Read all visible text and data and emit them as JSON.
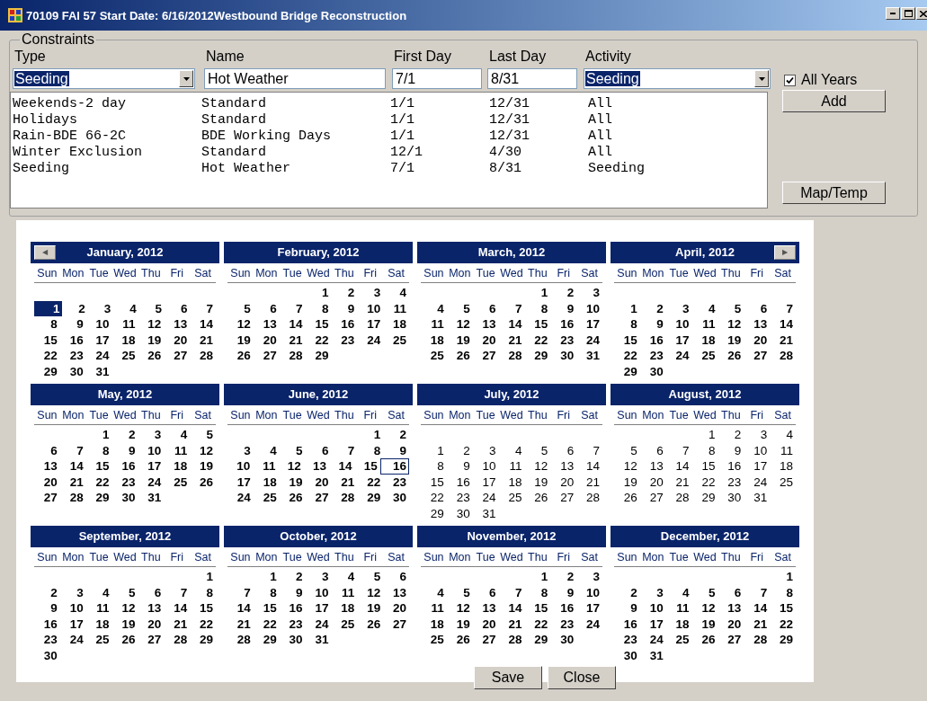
{
  "window": {
    "title": "70109 FAI 57 Start Date: 6/16/2012Westbound Bridge Reconstruction"
  },
  "constraints": {
    "title": "Constraints",
    "fields": [
      {
        "label": "Type",
        "kind": "combo",
        "value": "Seeding",
        "text_selected": true
      },
      {
        "label": "Name",
        "kind": "text",
        "value": "Hot Weather",
        "text_selected": false
      },
      {
        "label": "First Day",
        "kind": "text",
        "value": "7/1",
        "text_selected": false
      },
      {
        "label": "Last Day",
        "kind": "text",
        "value": "8/31",
        "text_selected": false
      },
      {
        "label": "Activity",
        "kind": "combo",
        "value": "Seeding",
        "text_selected": true
      }
    ],
    "all_years": {
      "label": "All Years",
      "checked": true
    },
    "add_button": "Add",
    "map_button": "Map/Temp",
    "rows": [
      [
        "Weekends-2 day",
        "Standard",
        "1/1",
        "12/31",
        "All"
      ],
      [
        "Holidays",
        "Standard",
        "1/1",
        "12/31",
        "All"
      ],
      [
        "Rain-BDE 66-2C",
        "BDE Working Days",
        "1/1",
        "12/31",
        "All"
      ],
      [
        "Winter Exclusion",
        "Standard",
        "12/1",
        "4/30",
        "All"
      ],
      [
        "Seeding",
        "Hot Weather",
        "7/1",
        "8/31",
        "Seeding"
      ]
    ]
  },
  "calendar": {
    "prev_button": "◀",
    "next_button": "▶",
    "months": [
      {
        "title": "January, 2012",
        "bold": true,
        "leading_blank_week": true,
        "weekdays": [
          "Sun",
          "Mon",
          "Tue",
          "Wed",
          "Thu",
          "Fri",
          "Sat"
        ],
        "weeks": [
          {
            "sun": {
              "day": "1",
              "kind": "selected"
            },
            "mon": "2",
            "tue": "3",
            "wed": "4",
            "thu": "5",
            "fri": "6",
            "sat": "7"
          },
          {
            "sun": "8",
            "mon": "9",
            "tue": "10",
            "wed": "11",
            "thu": "12",
            "fri": "13",
            "sat": "14"
          },
          {
            "sun": "15",
            "mon": "16",
            "tue": "17",
            "wed": "18",
            "thu": "19",
            "fri": "20",
            "sat": "21"
          },
          {
            "sun": "22",
            "mon": "23",
            "tue": "24",
            "wed": "25",
            "thu": "26",
            "fri": "27",
            "sat": "28"
          },
          {
            "sun": "29",
            "mon": "30",
            "tue": "31"
          }
        ]
      },
      {
        "title": "February, 2012",
        "bold": true,
        "leading_blank_week": false,
        "weekdays": [
          "Sun",
          "Mon",
          "Tue",
          "Wed",
          "Thu",
          "Fri",
          "Sat"
        ],
        "weeks": [
          {
            "wed": "1",
            "thu": "2",
            "fri": "3",
            "sat": "4"
          },
          {
            "sun": "5",
            "mon": "6",
            "tue": "7",
            "wed": "8",
            "thu": "9",
            "fri": "10",
            "sat": "11"
          },
          {
            "sun": "12",
            "mon": "13",
            "tue": "14",
            "wed": "15",
            "thu": "16",
            "fri": "17",
            "sat": "18"
          },
          {
            "sun": "19",
            "mon": "20",
            "tue": "21",
            "wed": "22",
            "thu": "23",
            "fri": "24",
            "sat": "25"
          },
          {
            "sun": "26",
            "mon": "27",
            "tue": "28",
            "wed": "29"
          }
        ]
      },
      {
        "title": "March, 2012",
        "bold": true,
        "leading_blank_week": false,
        "weekdays": [
          "Sun",
          "Mon",
          "Tue",
          "Wed",
          "Thu",
          "Fri",
          "Sat"
        ],
        "weeks": [
          {
            "thu": "1",
            "fri": "2",
            "sat": "3"
          },
          {
            "sun": "4",
            "mon": "5",
            "tue": "6",
            "wed": "7",
            "thu": "8",
            "fri": "9",
            "sat": "10"
          },
          {
            "sun": "11",
            "mon": "12",
            "tue": "13",
            "wed": "14",
            "thu": "15",
            "fri": "16",
            "sat": "17"
          },
          {
            "sun": "18",
            "mon": "19",
            "tue": "20",
            "wed": "21",
            "thu": "22",
            "fri": "23",
            "sat": "24"
          },
          {
            "sun": "25",
            "mon": "26",
            "tue": "27",
            "wed": "28",
            "thu": "29",
            "fri": "30",
            "sat": "31"
          }
        ]
      },
      {
        "title": "April, 2012",
        "bold": true,
        "leading_blank_week": true,
        "weekdays": [
          "Sun",
          "Mon",
          "Tue",
          "Wed",
          "Thu",
          "Fri",
          "Sat"
        ],
        "weeks": [
          {
            "sun": "1",
            "mon": "2",
            "tue": "3",
            "wed": "4",
            "thu": "5",
            "fri": "6",
            "sat": "7"
          },
          {
            "sun": "8",
            "mon": "9",
            "tue": "10",
            "wed": "11",
            "thu": "12",
            "fri": "13",
            "sat": "14"
          },
          {
            "sun": "15",
            "mon": "16",
            "tue": "17",
            "wed": "18",
            "thu": "19",
            "fri": "20",
            "sat": "21"
          },
          {
            "sun": "22",
            "mon": "23",
            "tue": "24",
            "wed": "25",
            "thu": "26",
            "fri": "27",
            "sat": "28"
          },
          {
            "sun": "29",
            "mon": "30"
          }
        ]
      },
      {
        "title": "May, 2012",
        "bold": true,
        "leading_blank_week": false,
        "weekdays": [
          "Sun",
          "Mon",
          "Tue",
          "Wed",
          "Thu",
          "Fri",
          "Sat"
        ],
        "weeks": [
          {
            "tue": "1",
            "wed": "2",
            "thu": "3",
            "fri": "4",
            "sat": "5"
          },
          {
            "sun": "6",
            "mon": "7",
            "tue": "8",
            "wed": "9",
            "thu": "10",
            "fri": "11",
            "sat": "12"
          },
          {
            "sun": "13",
            "mon": "14",
            "tue": "15",
            "wed": "16",
            "thu": "17",
            "fri": "18",
            "sat": "19"
          },
          {
            "sun": "20",
            "mon": "21",
            "tue": "22",
            "wed": "23",
            "thu": "24",
            "fri": "25",
            "sat": "26"
          },
          {
            "sun": "27",
            "mon": "28",
            "tue": "29",
            "wed": "30",
            "thu": "31"
          }
        ]
      },
      {
        "title": "June, 2012",
        "bold": true,
        "leading_blank_week": false,
        "weekdays": [
          "Sun",
          "Mon",
          "Tue",
          "Wed",
          "Thu",
          "Fri",
          "Sat"
        ],
        "weeks": [
          {
            "fri": "1",
            "sat": "2"
          },
          {
            "sun": "3",
            "mon": "4",
            "tue": "5",
            "wed": "6",
            "thu": "7",
            "fri": "8",
            "sat": "9"
          },
          {
            "sun": "10",
            "mon": "11",
            "tue": "12",
            "wed": "13",
            "thu": "14",
            "fri": "15",
            "sat": {
              "day": "16",
              "kind": "today"
            }
          },
          {
            "sun": "17",
            "mon": "18",
            "tue": "19",
            "wed": "20",
            "thu": "21",
            "fri": "22",
            "sat": "23"
          },
          {
            "sun": "24",
            "mon": "25",
            "tue": "26",
            "wed": "27",
            "thu": "28",
            "fri": "29",
            "sat": "30"
          }
        ]
      },
      {
        "title": "July, 2012",
        "bold": false,
        "leading_blank_week": true,
        "weekdays": [
          "Sun",
          "Mon",
          "Tue",
          "Wed",
          "Thu",
          "Fri",
          "Sat"
        ],
        "weeks": [
          {
            "sun": "1",
            "mon": "2",
            "tue": "3",
            "wed": "4",
            "thu": "5",
            "fri": "6",
            "sat": "7"
          },
          {
            "sun": "8",
            "mon": "9",
            "tue": "10",
            "wed": "11",
            "thu": "12",
            "fri": "13",
            "sat": "14"
          },
          {
            "sun": "15",
            "mon": "16",
            "tue": "17",
            "wed": "18",
            "thu": "19",
            "fri": "20",
            "sat": "21"
          },
          {
            "sun": "22",
            "mon": "23",
            "tue": "24",
            "wed": "25",
            "thu": "26",
            "fri": "27",
            "sat": "28"
          },
          {
            "sun": "29",
            "mon": "30",
            "tue": "31"
          }
        ]
      },
      {
        "title": "August, 2012",
        "bold": false,
        "leading_blank_week": false,
        "weekdays": [
          "Sun",
          "Mon",
          "Tue",
          "Wed",
          "Thu",
          "Fri",
          "Sat"
        ],
        "weeks": [
          {
            "wed": "1",
            "thu": "2",
            "fri": "3",
            "sat": "4"
          },
          {
            "sun": "5",
            "mon": "6",
            "tue": "7",
            "wed": "8",
            "thu": "9",
            "fri": "10",
            "sat": "11"
          },
          {
            "sun": "12",
            "mon": "13",
            "tue": "14",
            "wed": "15",
            "thu": "16",
            "fri": "17",
            "sat": "18"
          },
          {
            "sun": "19",
            "mon": "20",
            "tue": "21",
            "wed": "22",
            "thu": "23",
            "fri": "24",
            "sat": "25"
          },
          {
            "sun": "26",
            "mon": "27",
            "tue": "28",
            "wed": "29",
            "thu": "30",
            "fri": "31"
          }
        ]
      },
      {
        "title": "September, 2012",
        "bold": true,
        "leading_blank_week": false,
        "weekdays": [
          "Sun",
          "Mon",
          "Tue",
          "Wed",
          "Thu",
          "Fri",
          "Sat"
        ],
        "weeks": [
          {
            "sat": "1"
          },
          {
            "sun": "2",
            "mon": "3",
            "tue": "4",
            "wed": "5",
            "thu": "6",
            "fri": "7",
            "sat": "8"
          },
          {
            "sun": "9",
            "mon": "10",
            "tue": "11",
            "wed": "12",
            "thu": "13",
            "fri": "14",
            "sat": "15"
          },
          {
            "sun": "16",
            "mon": "17",
            "tue": "18",
            "wed": "19",
            "thu": "20",
            "fri": "21",
            "sat": "22"
          },
          {
            "sun": "23",
            "mon": "24",
            "tue": "25",
            "wed": "26",
            "thu": "27",
            "fri": "28",
            "sat": "29"
          },
          {
            "sun": "30"
          }
        ]
      },
      {
        "title": "October, 2012",
        "bold": true,
        "leading_blank_week": false,
        "weekdays": [
          "Sun",
          "Mon",
          "Tue",
          "Wed",
          "Thu",
          "Fri",
          "Sat"
        ],
        "weeks": [
          {
            "mon": "1",
            "tue": "2",
            "wed": "3",
            "thu": "4",
            "fri": "5",
            "sat": "6"
          },
          {
            "sun": "7",
            "mon": "8",
            "tue": "9",
            "wed": "10",
            "thu": "11",
            "fri": "12",
            "sat": "13"
          },
          {
            "sun": "14",
            "mon": "15",
            "tue": "16",
            "wed": "17",
            "thu": "18",
            "fri": "19",
            "sat": "20"
          },
          {
            "sun": "21",
            "mon": "22",
            "tue": "23",
            "wed": "24",
            "thu": "25",
            "fri": "26",
            "sat": "27"
          },
          {
            "sun": "28",
            "mon": "29",
            "tue": "30",
            "wed": "31"
          }
        ]
      },
      {
        "title": "November, 2012",
        "bold": true,
        "leading_blank_week": false,
        "weekdays": [
          "Sun",
          "Mon",
          "Tue",
          "Wed",
          "Thu",
          "Fri",
          "Sat"
        ],
        "weeks": [
          {
            "thu": "1",
            "fri": "2",
            "sat": "3"
          },
          {
            "sun": "4",
            "mon": "5",
            "tue": "6",
            "wed": "7",
            "thu": "8",
            "fri": "9",
            "sat": "10"
          },
          {
            "sun": "11",
            "mon": "12",
            "tue": "13",
            "wed": "14",
            "thu": "15",
            "fri": "16",
            "sat": "17"
          },
          {
            "sun": "18",
            "mon": "19",
            "tue": "20",
            "wed": "21",
            "thu": "22",
            "fri": "23",
            "sat": "24"
          },
          {
            "sun": "25",
            "mon": "26",
            "tue": "27",
            "wed": "28",
            "thu": "29",
            "fri": "30"
          }
        ]
      },
      {
        "title": "December, 2012",
        "bold": true,
        "leading_blank_week": false,
        "weekdays": [
          "Sun",
          "Mon",
          "Tue",
          "Wed",
          "Thu",
          "Fri",
          "Sat"
        ],
        "weeks": [
          {
            "sat": "1"
          },
          {
            "sun": "2",
            "mon": "3",
            "tue": "4",
            "wed": "5",
            "thu": "6",
            "fri": "7",
            "sat": "8"
          },
          {
            "sun": "9",
            "mon": "10",
            "tue": "11",
            "wed": "12",
            "thu": "13",
            "fri": "14",
            "sat": "15"
          },
          {
            "sun": "16",
            "mon": "17",
            "tue": "18",
            "wed": "19",
            "thu": "20",
            "fri": "21",
            "sat": "22"
          },
          {
            "sun": "23",
            "mon": "24",
            "tue": "25",
            "wed": "26",
            "thu": "27",
            "fri": "28",
            "sat": "29"
          },
          {
            "sun": "30",
            "mon": "31"
          }
        ]
      }
    ]
  },
  "buttons": [
    "Save",
    "Close"
  ]
}
